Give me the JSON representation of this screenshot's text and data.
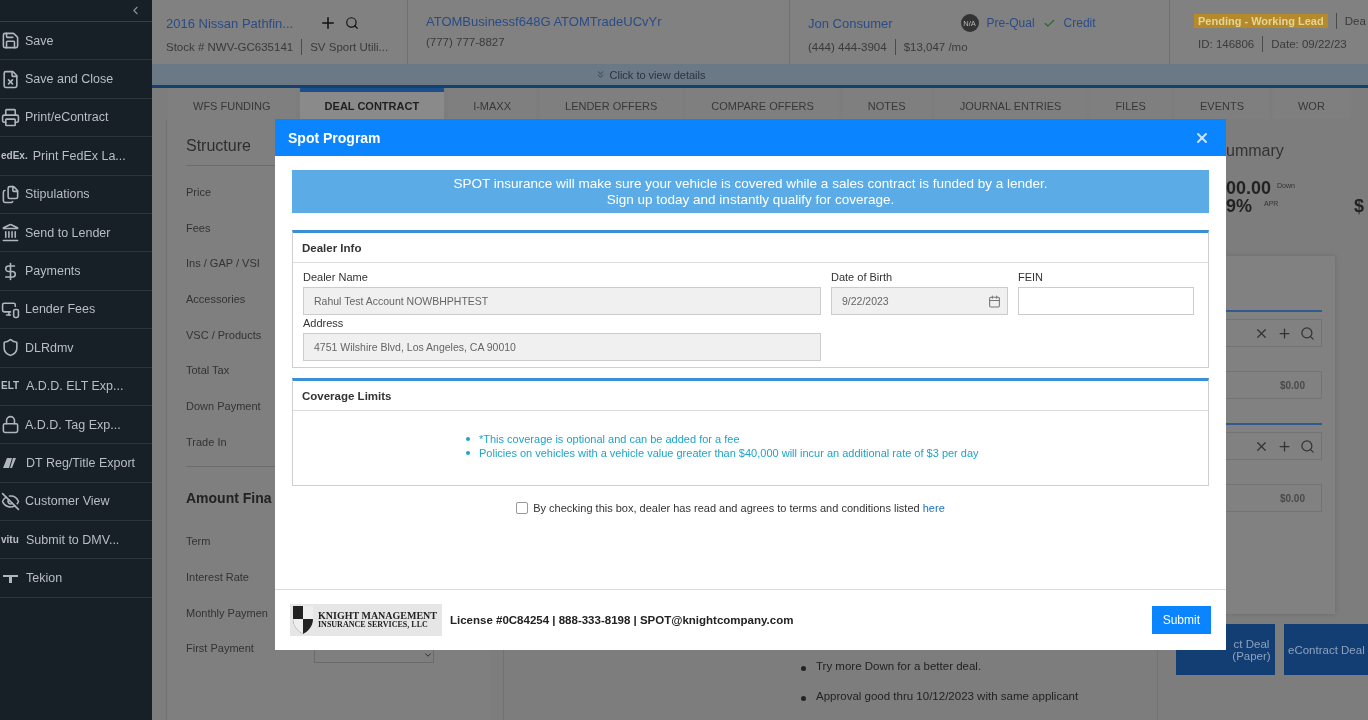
{
  "sidebar": {
    "items": [
      {
        "label": "Save"
      },
      {
        "label": "Save and Close"
      },
      {
        "label": "Print/eContract"
      },
      {
        "label": "Print FedEx La...",
        "icon_text": "edEx."
      },
      {
        "label": "Stipulations"
      },
      {
        "label": "Send to Lender"
      },
      {
        "label": "Payments"
      },
      {
        "label": "Lender Fees"
      },
      {
        "label": "DLRdmv"
      },
      {
        "label": "A.D.D. ELT Exp...",
        "icon_text": "ELT"
      },
      {
        "label": "A.D.D. Tag Exp..."
      },
      {
        "label": "DT Reg/Title Export"
      },
      {
        "label": "Customer View"
      },
      {
        "label": "Submit to DMV...",
        "icon_text": "vitu"
      },
      {
        "label": "Tekion"
      }
    ]
  },
  "header": {
    "vehicle": {
      "title": "2016 Nissan Pathfin...",
      "stock": "Stock # NWV-GC635141",
      "type": "SV Sport Utili..."
    },
    "business": {
      "name": "ATOMBusinessf648G ATOMTradeUCvYr",
      "phone": "(777) 777-8827"
    },
    "customer": {
      "name": "Jon Consumer",
      "prequal_badge": "N/A",
      "prequal": "Pre-Qual",
      "credit_verified": true,
      "credit": "Credit",
      "phone": "(444) 444-3904",
      "payment": "$13,047 /mo"
    },
    "deal": {
      "status": "Pending - Working Lead",
      "extra": "Dea",
      "id": "ID: 146806",
      "date": "Date: 09/22/23"
    },
    "details_toggle": "Click to view details"
  },
  "tabs": [
    {
      "label": "WFS FUNDING",
      "selected": false
    },
    {
      "label": "DEAL CONTRACT",
      "selected": true
    },
    {
      "label": "I-MAXX",
      "selected": false
    },
    {
      "label": "LENDER OFFERS",
      "selected": false
    },
    {
      "label": "COMPARE OFFERS",
      "selected": false
    },
    {
      "label": "NOTES",
      "selected": false
    },
    {
      "label": "JOURNAL ENTRIES",
      "selected": false
    },
    {
      "label": "FILES",
      "selected": false
    },
    {
      "label": "EVENTS",
      "selected": false
    },
    {
      "label": "WOR",
      "selected": false
    }
  ],
  "structure": {
    "title": "Structure",
    "rows": [
      "Price",
      "Fees",
      "Ins / GAP / VSI",
      "Accessories",
      "VSC / Products",
      "Total Tax",
      "Down Payment",
      "Trade In"
    ],
    "section": "Amount Fina",
    "rows2": [
      "Term",
      "Interest Rate",
      "Monthly Paymen",
      "First Payment"
    ]
  },
  "notes": [
    "Try more Down for a better deal.",
    "Approval good thru 10/12/2023 with same applicant"
  ],
  "summary": {
    "title": "ummary",
    "down": "00.00",
    "down_label": "Down",
    "apr": "9%",
    "apr_label": "APR",
    "other": "$",
    "amounts": [
      "$0.00",
      "$0.00"
    ]
  },
  "actions": [
    {
      "lines": [
        "ct Deal",
        "(Paper)"
      ]
    },
    {
      "lines": [
        "eContract Deal"
      ]
    }
  ],
  "modal": {
    "title": "Spot Program",
    "banner": [
      "SPOT insurance will make sure your vehicle is covered while a sales contract is funded by a lender.",
      "Sign up today and instantly qualify for coverage."
    ],
    "dealer_info": {
      "title": "Dealer Info",
      "dealer_name": {
        "label": "Dealer Name",
        "value": "Rahul Test Account NOWBHPHTEST"
      },
      "date_of_birth": {
        "label": "Date of Birth",
        "value": "9/22/2023"
      },
      "fein": {
        "label": "FEIN"
      },
      "address": {
        "label": "Address",
        "value": "4751 Wilshire Blvd, Los Angeles, CA 90010"
      }
    },
    "coverage": {
      "title": "Coverage Limits",
      "items": [
        "*This coverage is optional and can be added for a fee",
        "Policies on vehicles with a vehicle value greater than $40,000 will incur an additional rate of $3 per day"
      ]
    },
    "terms": {
      "checked": false,
      "text": "By checking this box, dealer has read and agrees to terms and conditions listed ",
      "link": "here"
    },
    "logo": [
      "KNIGHT MANAGEMENT",
      "INSURANCE SERVICES, LLC"
    ],
    "contact": "License #0C84254 | 888-333-8198 | SPOT@knightcompany.com",
    "submit": "Submit"
  }
}
